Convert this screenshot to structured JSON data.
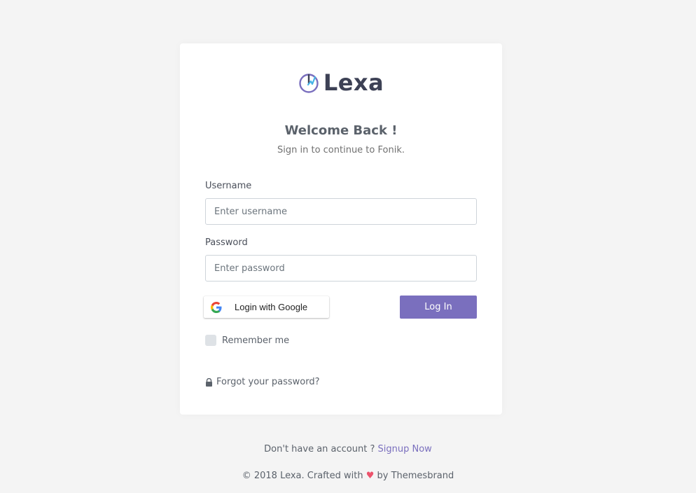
{
  "logo": {
    "text": "Lexa"
  },
  "header": {
    "title": "Welcome Back !",
    "subtitle": "Sign in to continue to Fonik."
  },
  "form": {
    "username_label": "Username",
    "username_placeholder": "Enter username",
    "username_value": "",
    "password_label": "Password",
    "password_placeholder": "Enter password",
    "password_value": "",
    "google_button": "Login with Google",
    "login_button": "Log In",
    "remember_label": "Remember me",
    "remember_checked": false,
    "forgot_link": "Forgot your password?"
  },
  "footer": {
    "signup_prompt": "Don't have an account ? ",
    "signup_link": "Signup Now",
    "copyright_prefix": "© 2018 Lexa. Crafted with ",
    "heart": "♥",
    "copyright_suffix": " by Themesbrand"
  },
  "colors": {
    "accent": "#7a6fbe",
    "background": "#f4f4f4",
    "heart": "#ec536c"
  },
  "icons": [
    "lexa-logo-icon",
    "google-icon",
    "lock-icon",
    "heart-icon"
  ]
}
